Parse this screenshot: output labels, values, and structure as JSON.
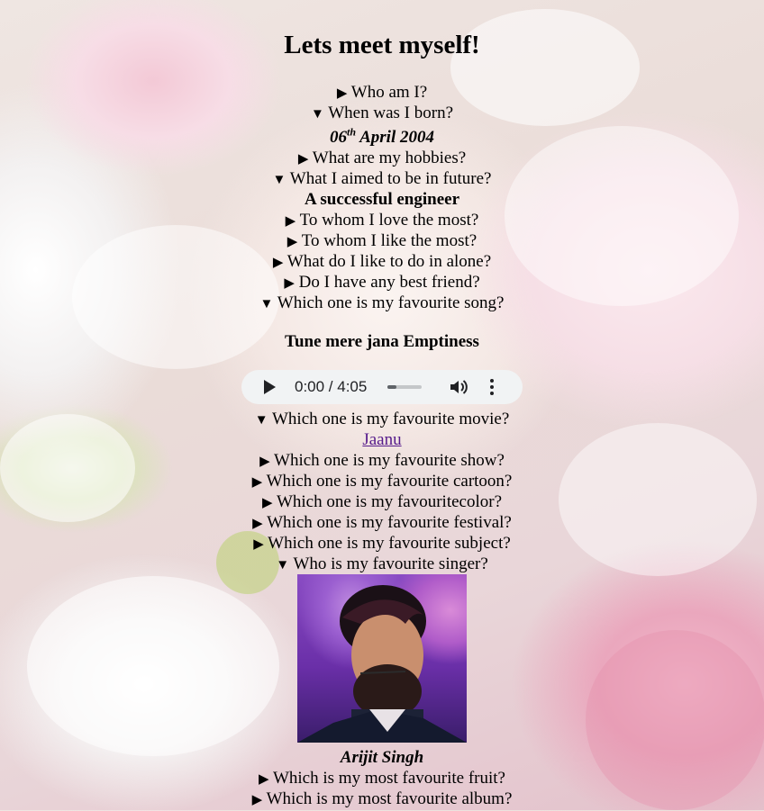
{
  "title": "Lets meet myself!",
  "items": [
    {
      "marker": "▶",
      "text": "Who am I?"
    },
    {
      "marker": "▼",
      "text": "When was I born?"
    },
    {
      "marker": "▶",
      "text": "What are my hobbies?"
    },
    {
      "marker": "▼",
      "text": "What I aimed to be in future?"
    },
    {
      "marker": "▶",
      "text": "To whom I love the most?"
    },
    {
      "marker": "▶",
      "text": "To whom I like the most?"
    },
    {
      "marker": "▶",
      "text": "What do I like to do in alone?"
    },
    {
      "marker": "▶",
      "text": "Do I have any best friend?"
    },
    {
      "marker": "▼",
      "text": "Which one is my favourite song?"
    },
    {
      "marker": "▼",
      "text": "Which one is my favourite movie?"
    },
    {
      "marker": "▶",
      "text": "Which one is my favourite show?"
    },
    {
      "marker": "▶",
      "text": "Which one is my favourite cartoon?"
    },
    {
      "marker": "▶",
      "text": "Which one is my favouritecolor?"
    },
    {
      "marker": "▶",
      "text": "Which one is my favourite festival?"
    },
    {
      "marker": "▶",
      "text": "Which one is my favourite subject?"
    },
    {
      "marker": "▼",
      "text": "Who is my favourite singer?"
    },
    {
      "marker": "▶",
      "text": "Which is my most favourite fruit?"
    },
    {
      "marker": "▶",
      "text": "Which is my most favourite album?"
    }
  ],
  "answers": {
    "born_day": "06",
    "born_suffix": "th",
    "born_rest": " April 2004",
    "future": "A successful engineer",
    "song": "Tune mere jana Emptiness",
    "movie": "Jaanu",
    "singer": "Arijit Singh"
  },
  "audio": {
    "time": "0:00 / 4:05",
    "progress": 0.0
  },
  "icons": [
    "play-icon",
    "volume-icon",
    "more-options-icon"
  ]
}
